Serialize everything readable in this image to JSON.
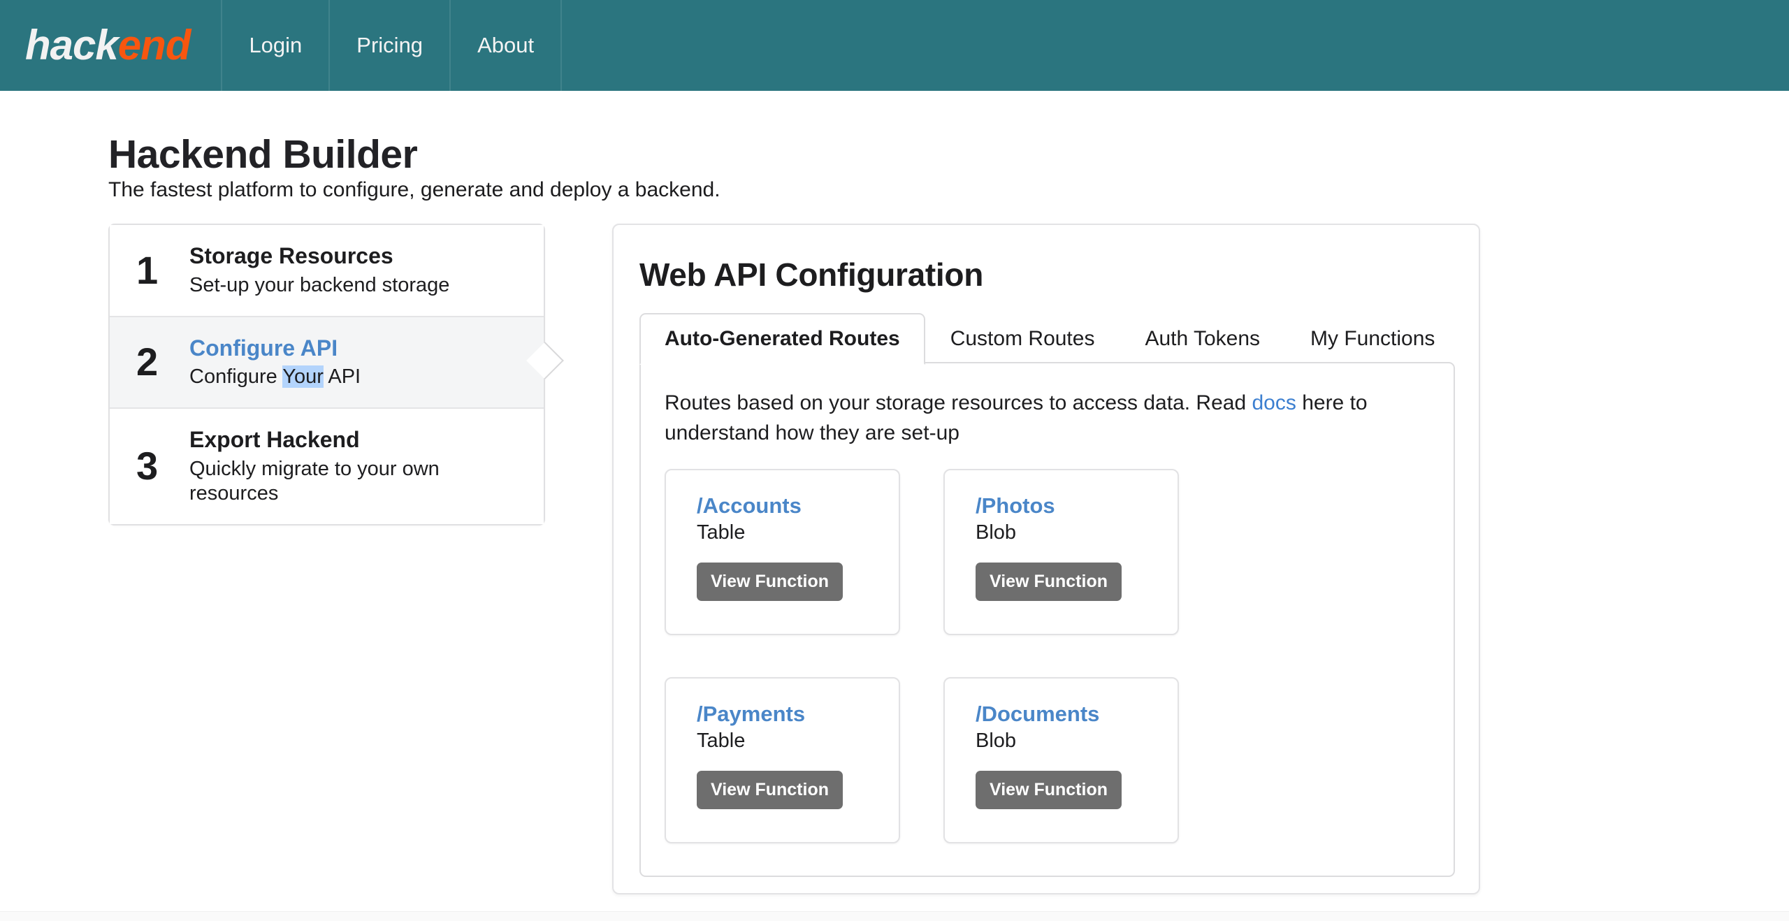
{
  "header": {
    "brand_primary": "hack",
    "brand_accent": "end",
    "brand_accent_color": "#f8560f",
    "background_color": "#2b757f",
    "nav": [
      {
        "label": "Login"
      },
      {
        "label": "Pricing"
      },
      {
        "label": "About"
      }
    ]
  },
  "page": {
    "title": "Hackend Builder",
    "subtitle": "The fastest platform to configure, generate and deploy a backend."
  },
  "steps": [
    {
      "number": "1",
      "name": "Storage Resources",
      "description": "Set-up your backend storage",
      "active": false
    },
    {
      "number": "2",
      "name": "Configure API",
      "description_pre": "Configure ",
      "description_selected": "Your",
      "description_post": " API",
      "active": true,
      "active_color": "#4a86c8",
      "selection_color": "#b3d4fc"
    },
    {
      "number": "3",
      "name": "Export Hackend",
      "description": "Quickly migrate to your own resources",
      "active": false
    }
  ],
  "panel": {
    "title": "Web API Configuration",
    "tabs": [
      {
        "label": "Auto-Generated Routes",
        "active": true
      },
      {
        "label": "Custom Routes",
        "active": false
      },
      {
        "label": "Auth Tokens",
        "active": false
      },
      {
        "label": "My Functions",
        "active": false
      }
    ],
    "description": {
      "pre": "Routes based on your storage resources to access data. Read ",
      "link": "docs",
      "post": " here to understand how they are set-up",
      "link_color": "#3c7fd0"
    },
    "routes": [
      {
        "path": "/Accounts",
        "type": "Table",
        "button": "View Function"
      },
      {
        "path": "/Photos",
        "type": "Blob",
        "button": "View Function"
      },
      {
        "path": "/Payments",
        "type": "Table",
        "button": "View Function"
      },
      {
        "path": "/Documents",
        "type": "Blob",
        "button": "View Function"
      }
    ]
  }
}
